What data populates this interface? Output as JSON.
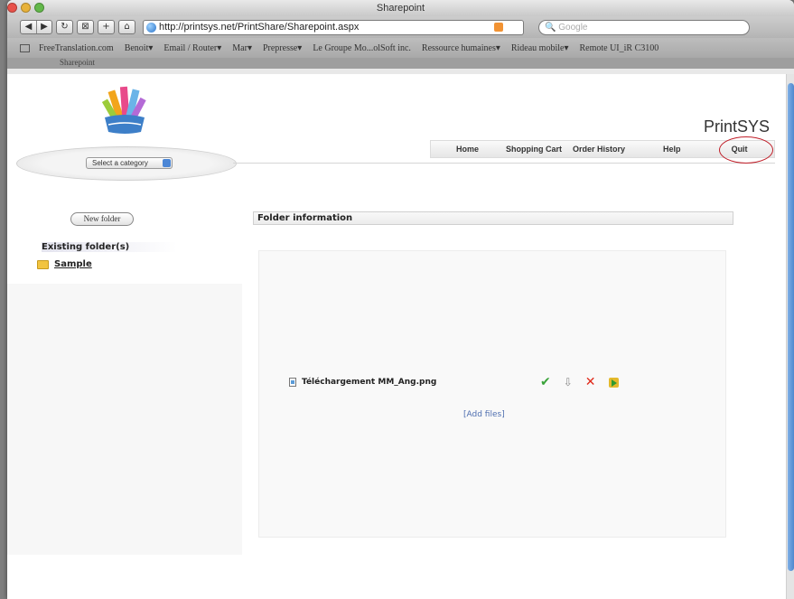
{
  "window": {
    "title": "Sharepoint"
  },
  "toolbar": {
    "url": "http://printsys.net/PrintShare/Sharepoint.aspx",
    "search_placeholder": "Google"
  },
  "bookmarks": [
    "FreeTranslation.com",
    "Benoit▾",
    "Email / Router▾",
    "Mar▾",
    "Prepresse▾",
    "Le Groupe Mo...olSoft inc.",
    "Ressource humaines▾",
    "Rideau mobile▾",
    "Remote UI_iR C3100"
  ],
  "tab": {
    "label": "Sharepoint"
  },
  "header": {
    "brand": "PrintSYS",
    "category_select": "Select a category",
    "nav": [
      "Home",
      "Shopping Cart",
      "Order History",
      "Help",
      "Quit"
    ]
  },
  "sidebar": {
    "new_folder": "New folder",
    "existing_heading": "Existing folder(s)",
    "folders": [
      "Sample"
    ]
  },
  "main": {
    "folder_info_title": "Folder information",
    "file_name": "Téléchargement MM_Ang.png",
    "add_files": "[Add files]"
  }
}
